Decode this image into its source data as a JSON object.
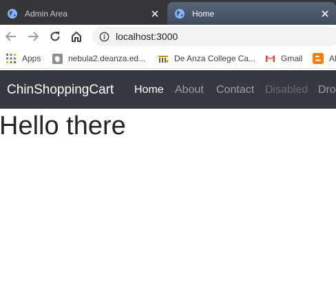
{
  "tabs": [
    {
      "title": "Admin Area",
      "active": false,
      "icon": "globe-icon"
    },
    {
      "title": "Home",
      "active": true,
      "icon": "globe-icon"
    }
  ],
  "toolbar": {
    "url": "localhost:3000",
    "icons": [
      "back-icon",
      "forward-icon",
      "reload-icon",
      "home-icon",
      "info-icon"
    ]
  },
  "bookmarks": [
    {
      "label": "Apps",
      "icon": "apps-grid-icon"
    },
    {
      "label": "nebula2.deanza.ed...",
      "icon": "page-icon"
    },
    {
      "label": "De Anza College Ca...",
      "icon": "college-logo-icon"
    },
    {
      "label": "Gmail",
      "icon": "gmail-icon"
    },
    {
      "label": "Al",
      "icon": "blogger-icon"
    }
  ],
  "site": {
    "brand": "ChinShoppingCart",
    "nav": [
      "Home",
      "About",
      "Contact",
      "Disabled",
      "Dro"
    ],
    "heading": "Hello there"
  },
  "colors": {
    "tabstrip": "#35363a",
    "active_tab": "#4d5a6b",
    "navbar": "#343a40",
    "heading_text": "#212529"
  }
}
